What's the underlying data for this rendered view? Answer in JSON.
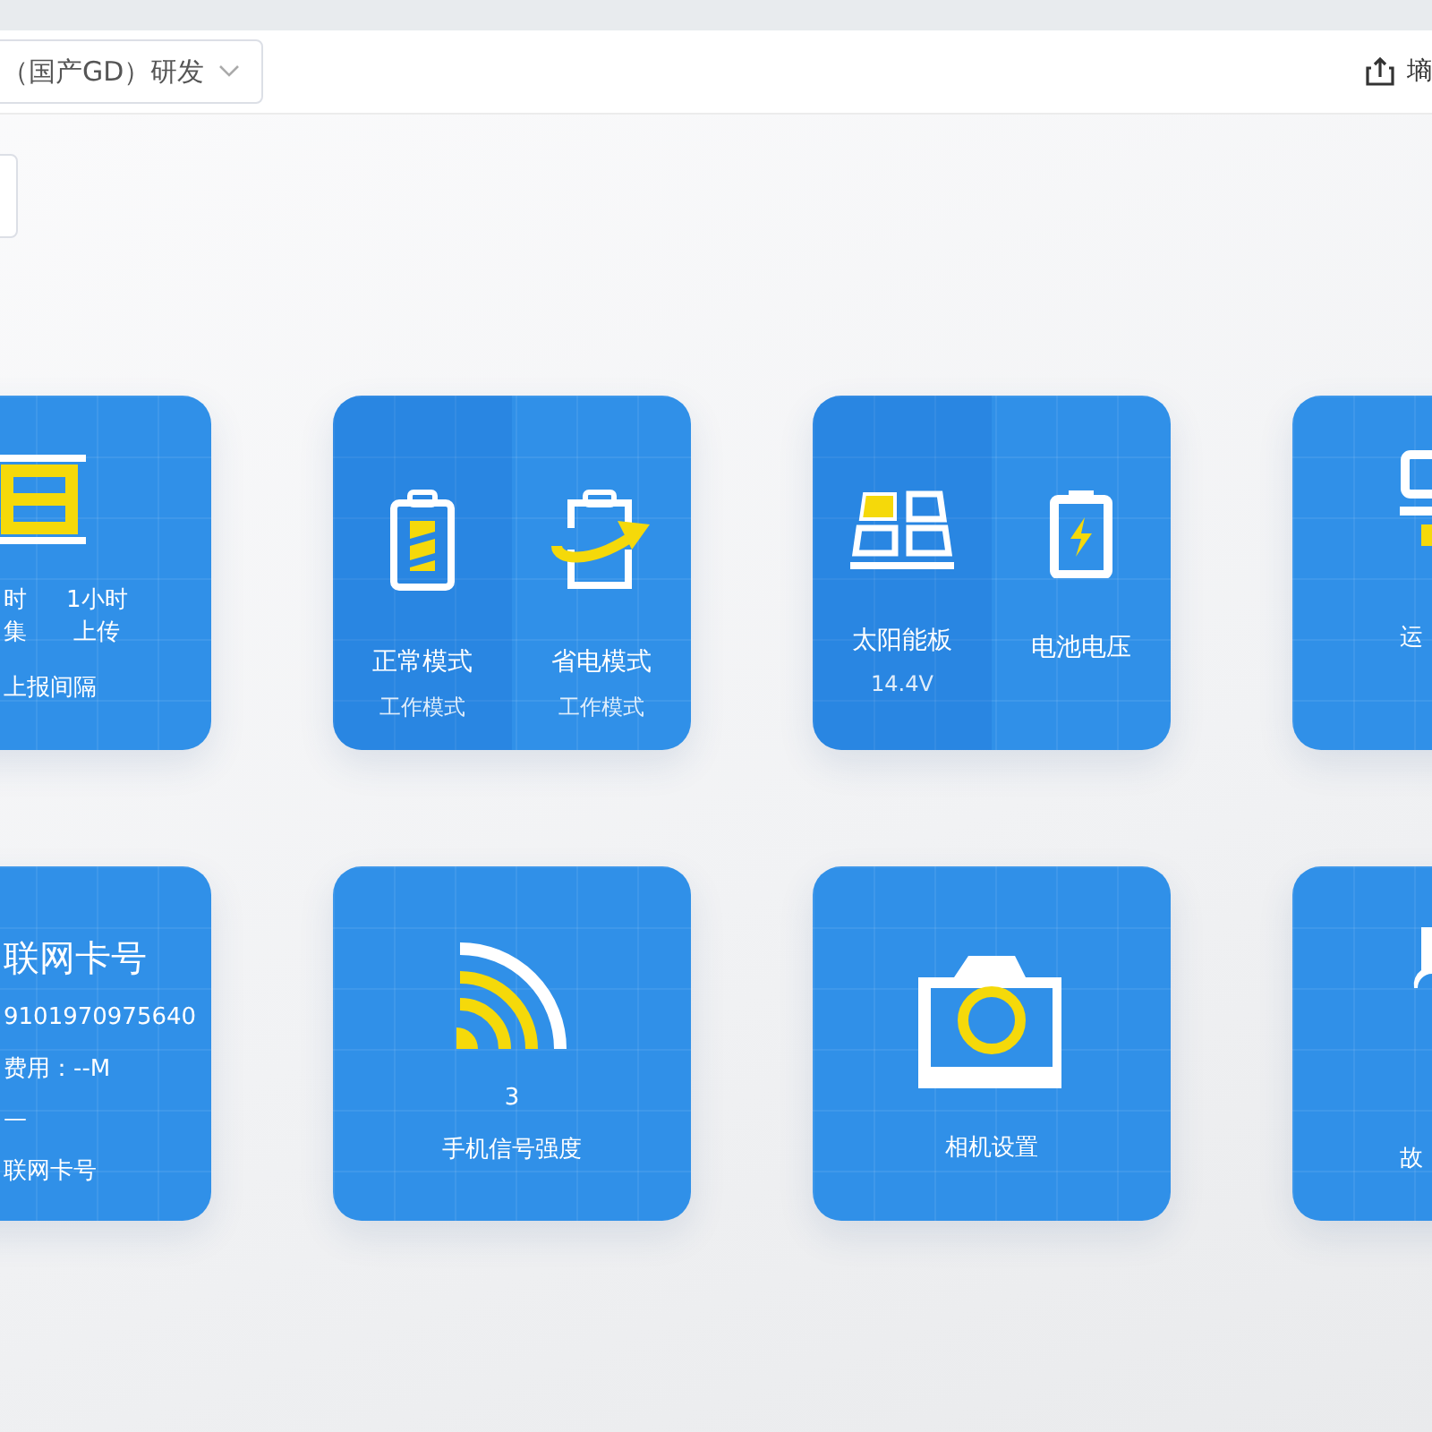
{
  "header": {
    "select_value": "（国产GD）研发",
    "export_label": "墒"
  },
  "cards": [
    {
      "kind": "interval",
      "columns": [
        {
          "top": "时",
          "bottom": "集"
        },
        {
          "top": "1小时",
          "bottom": "上传"
        }
      ],
      "label": "上报间隔"
    },
    {
      "kind": "split",
      "panels": [
        {
          "title": "正常模式",
          "subtitle": "工作模式"
        },
        {
          "title": "省电模式",
          "subtitle": "工作模式"
        }
      ]
    },
    {
      "kind": "split",
      "panels": [
        {
          "title": "太阳能板",
          "subtitle": "14.4V"
        },
        {
          "title": "电池电压"
        }
      ]
    },
    {
      "kind": "edge",
      "label": "运"
    },
    {
      "kind": "sim",
      "title": "联网卡号",
      "lines": [
        "9101970975640",
        "费用：--M",
        "—"
      ],
      "label": "联网卡号"
    },
    {
      "kind": "signal",
      "value": "3",
      "label": "手机信号强度"
    },
    {
      "kind": "camera",
      "label": "相机设置"
    },
    {
      "kind": "edge",
      "label": "故"
    }
  ]
}
